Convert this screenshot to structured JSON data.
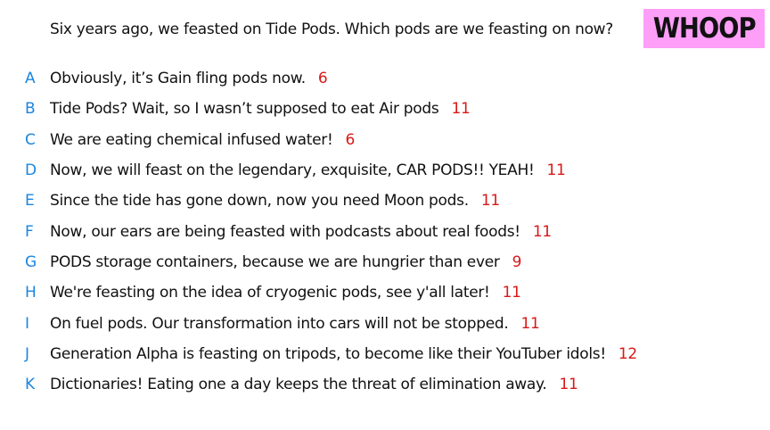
{
  "prompt": "Six years ago, we feasted on Tide Pods. Which pods are we feasting on now?",
  "badge": {
    "label": "WHOOP",
    "color": "#fd9ef8"
  },
  "colors": {
    "letter": "#1a86e0",
    "score": "#d81818"
  },
  "answers": [
    {
      "letter": "A",
      "text": "Obviously, it’s Gain fling pods now.",
      "score": "6"
    },
    {
      "letter": "B",
      "text": "Tide Pods? Wait, so I wasn’t supposed to eat Air pods",
      "score": "11"
    },
    {
      "letter": "C",
      "text": "We are eating chemical infused water!",
      "score": "6"
    },
    {
      "letter": "D",
      "text": "Now, we will feast on the legendary, exquisite, CAR PODS!! YEAH!",
      "score": "11"
    },
    {
      "letter": "E",
      "text": "Since the tide has gone down, now you need Moon pods.",
      "score": "11"
    },
    {
      "letter": "F",
      "text": "Now, our ears are being feasted with podcasts about real foods!",
      "score": "11"
    },
    {
      "letter": "G",
      "text": "PODS storage containers, because we are hungrier than ever",
      "score": "9"
    },
    {
      "letter": "H",
      "text": "We're feasting on the idea of cryogenic pods, see y'all later!",
      "score": "11"
    },
    {
      "letter": "I",
      "text": "On fuel pods. Our transformation into cars will not be stopped.",
      "score": "11"
    },
    {
      "letter": "J",
      "text": "Generation Alpha is feasting on tripods, to become like their YouTuber idols!",
      "score": "12"
    },
    {
      "letter": "K",
      "text": "Dictionaries! Eating one a day keeps the threat of elimination away.",
      "score": "11"
    }
  ]
}
